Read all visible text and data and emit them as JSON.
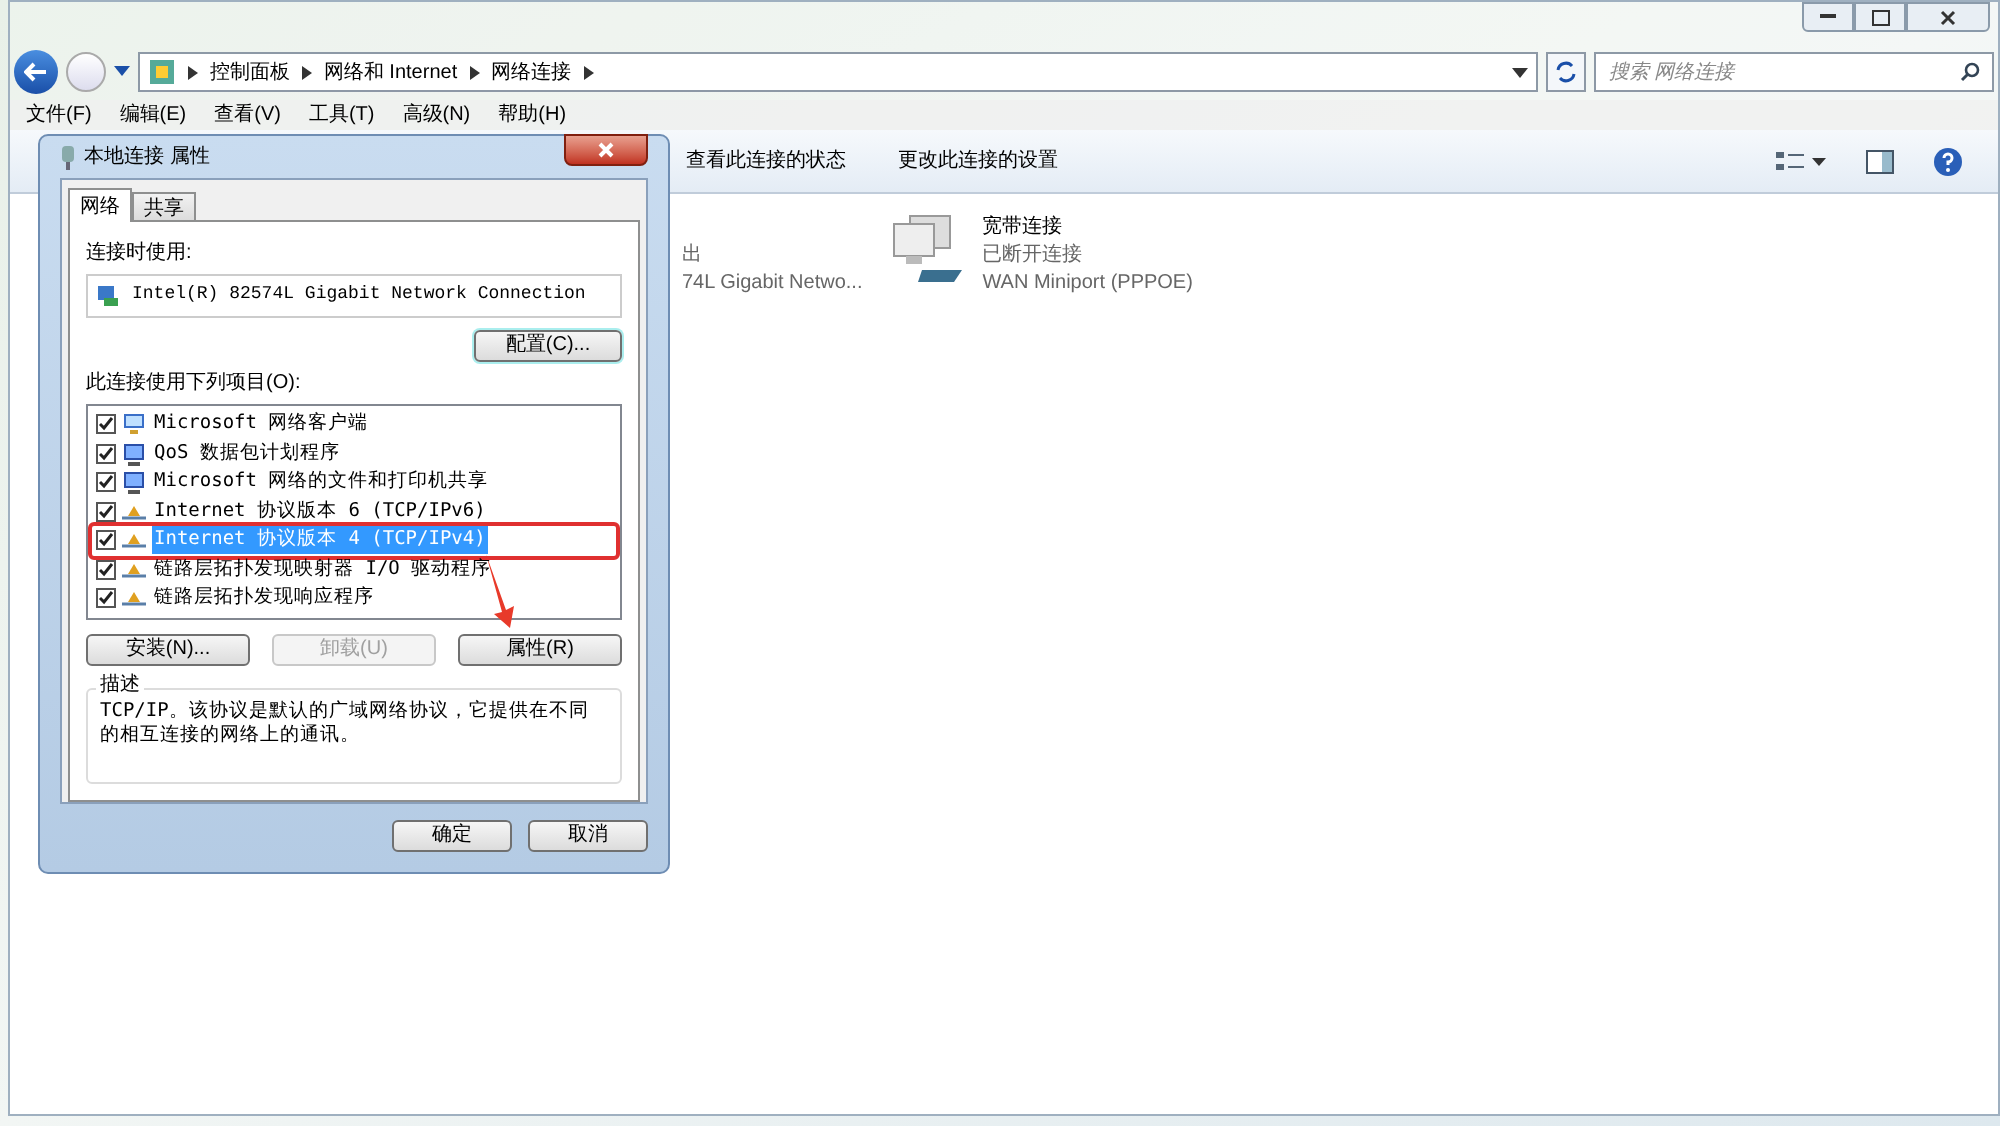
{
  "breadcrumb": [
    "控制面板",
    "网络和 Internet",
    "网络连接"
  ],
  "search": {
    "placeholder": "搜索 网络连接"
  },
  "menu": [
    "文件(F)",
    "编辑(E)",
    "查看(V)",
    "工具(T)",
    "高级(N)",
    "帮助(H)"
  ],
  "toolbar": [
    "查看此连接的状态",
    "更改此连接的设置"
  ],
  "connections": [
    {
      "kind": "partial",
      "lines": [
        "出",
        "74L Gigabit Netwo..."
      ]
    },
    {
      "kind": "full",
      "name": "宽带连接",
      "status": "已断开连接",
      "device": "WAN Miniport (PPPOE)"
    }
  ],
  "dialog": {
    "title": "本地连接 属性",
    "tabs": [
      {
        "label": "网络",
        "selected": true
      },
      {
        "label": "共享",
        "selected": false
      }
    ],
    "connect_using_label": "连接时使用:",
    "adapter": "Intel(R) 82574L Gigabit Network Connection",
    "configure_button": "配置(C)...",
    "items_label": "此连接使用下列项目(O):",
    "items": [
      {
        "kind": "client",
        "label": "Microsoft 网络客户端",
        "checked": true,
        "selected": false
      },
      {
        "kind": "service",
        "label": "QoS 数据包计划程序",
        "checked": true,
        "selected": false
      },
      {
        "kind": "service",
        "label": "Microsoft 网络的文件和打印机共享",
        "checked": true,
        "selected": false
      },
      {
        "kind": "protocol",
        "label": "Internet 协议版本 6 (TCP/IPv6)",
        "checked": true,
        "selected": false
      },
      {
        "kind": "protocol",
        "label": "Internet 协议版本 4 (TCP/IPv4)",
        "checked": true,
        "selected": true
      },
      {
        "kind": "protocol",
        "label": "链路层拓扑发现映射器 I/O 驱动程序",
        "checked": true,
        "selected": false
      },
      {
        "kind": "protocol",
        "label": "链路层拓扑发现响应程序",
        "checked": true,
        "selected": false
      }
    ],
    "item_buttons": [
      {
        "label": "安装(N)...",
        "disabled": false
      },
      {
        "label": "卸载(U)",
        "disabled": true
      },
      {
        "label": "属性(R)",
        "disabled": false
      }
    ],
    "description_title": "描述",
    "description": "TCP/IP。该协议是默认的广域网络协议，它提供在不同的相互连接的网络上的通讯。",
    "ok": "确定",
    "cancel": "取消"
  }
}
